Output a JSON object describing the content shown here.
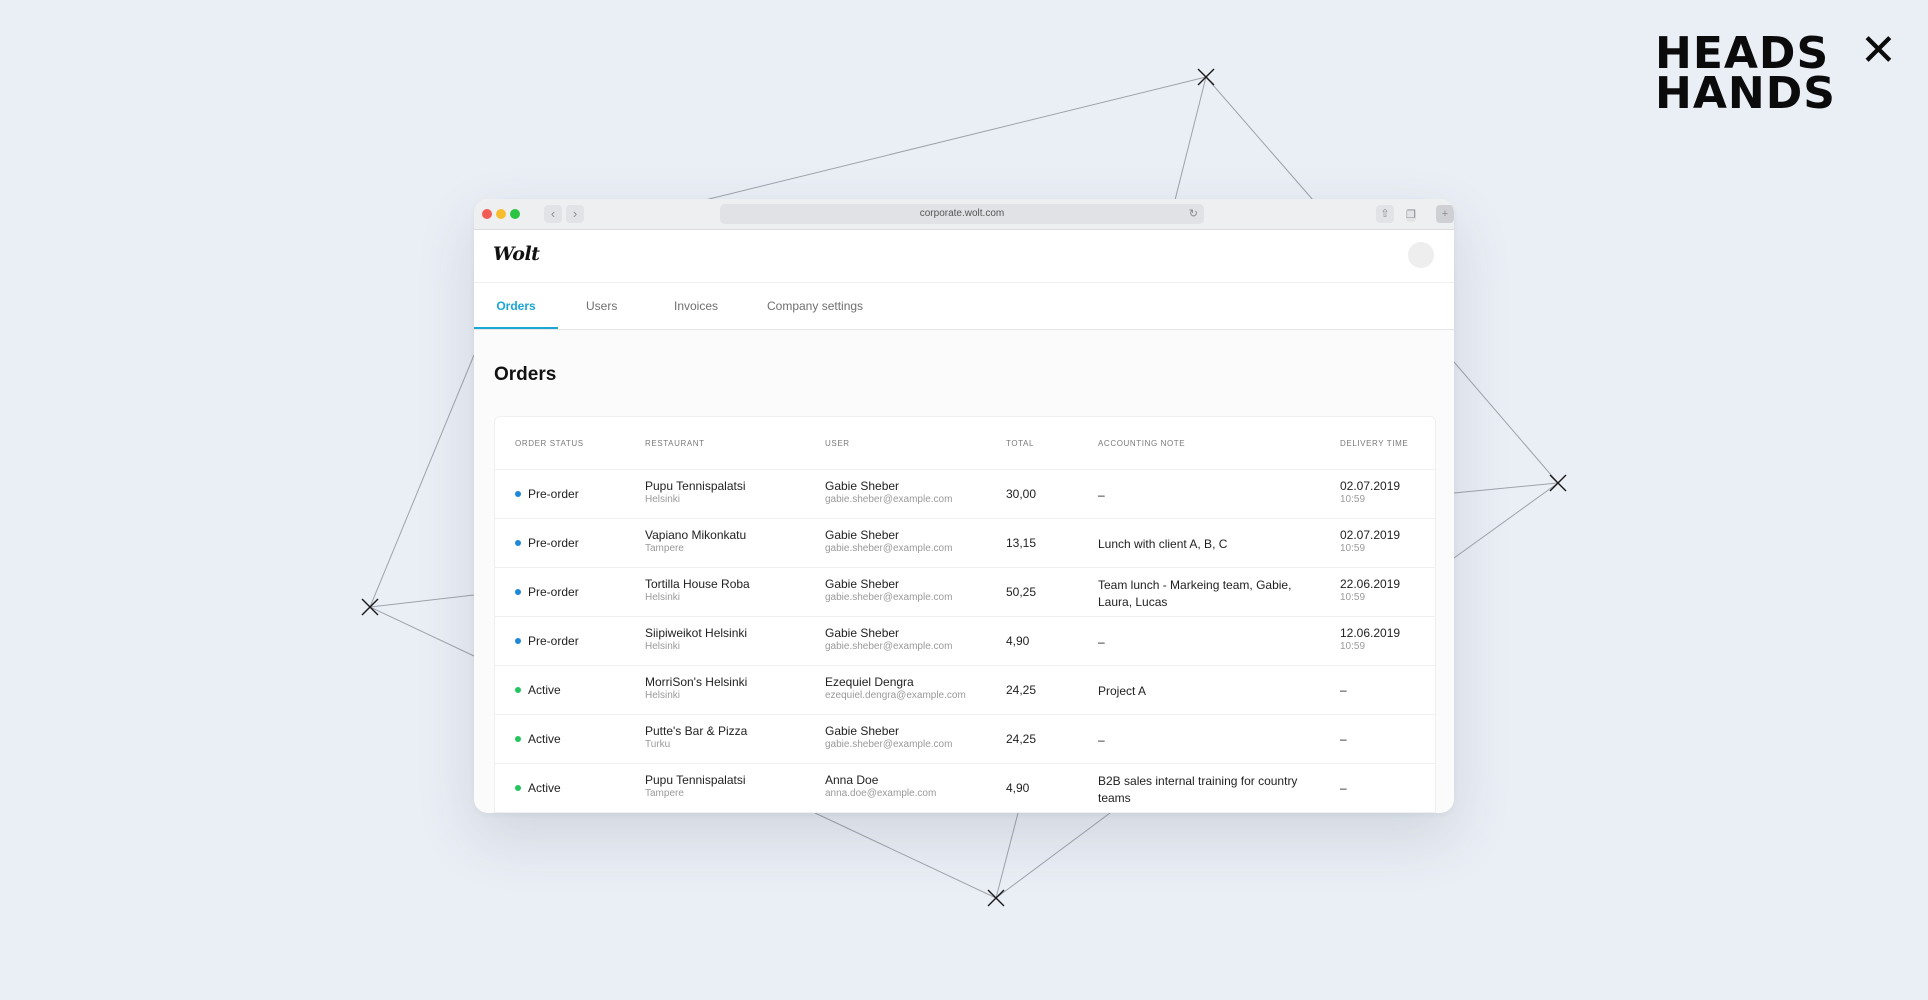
{
  "brand": {
    "line1": "HEADS",
    "line2": "HANDS",
    "mark": "✕"
  },
  "browser": {
    "url": "corporate.wolt.com"
  },
  "app": {
    "logo": "Wolt"
  },
  "tabs": [
    {
      "label": "Orders",
      "active": true
    },
    {
      "label": "Users",
      "active": false
    },
    {
      "label": "Invoices",
      "active": false
    },
    {
      "label": "Company settings",
      "active": false
    }
  ],
  "page": {
    "title": "Orders"
  },
  "colors": {
    "accent": "#1aa6d6",
    "preorder": "#1e88d8",
    "active": "#22c55e"
  },
  "table": {
    "headers": [
      "ORDER STATUS",
      "RESTAURANT",
      "USER",
      "TOTAL",
      "ACCOUNTING NOTE",
      "DELIVERY TIME"
    ],
    "rows": [
      {
        "status": "Pre-order",
        "restaurant": "Pupu Tennispalatsi",
        "city": "Helsinki",
        "user": "Gabie Sheber",
        "email": "gabie.sheber@example.com",
        "total": "30,00",
        "note": "–",
        "date": "02.07.2019",
        "time": "10:59"
      },
      {
        "status": "Pre-order",
        "restaurant": "Vapiano Mikonkatu",
        "city": "Tampere",
        "user": "Gabie Sheber",
        "email": "gabie.sheber@example.com",
        "total": "13,15",
        "note": "Lunch with client A, B, C",
        "date": "02.07.2019",
        "time": "10:59"
      },
      {
        "status": "Pre-order",
        "restaurant": "Tortilla House Roba",
        "city": "Helsinki",
        "user": "Gabie Sheber",
        "email": "gabie.sheber@example.com",
        "total": "50,25",
        "note": "Team lunch - Markeing team, Gabie,",
        "note2": "Laura, Lucas",
        "date": "22.06.2019",
        "time": "10:59"
      },
      {
        "status": "Pre-order",
        "restaurant": "Siipiweikot Helsinki",
        "city": "Helsinki",
        "user": "Gabie Sheber",
        "email": "gabie.sheber@example.com",
        "total": "4,90",
        "note": "–",
        "date": "12.06.2019",
        "time": "10:59"
      },
      {
        "status": "Active",
        "restaurant": "MorriSon's Helsinki",
        "city": "Helsinki",
        "user": "Ezequiel Dengra",
        "email": "ezequiel.dengra@example.com",
        "total": "24,25",
        "note": "Project A",
        "date": "–"
      },
      {
        "status": "Active",
        "restaurant": "Putte's Bar & Pizza",
        "city": "Turku",
        "user": "Gabie Sheber",
        "email": "gabie.sheber@example.com",
        "total": "24,25",
        "note": "–",
        "date": "–"
      },
      {
        "status": "Active",
        "restaurant": "Pupu Tennispalatsi",
        "city": "Tampere",
        "user": "Anna Doe",
        "email": "anna.doe@example.com",
        "total": "4,90",
        "note": "B2B sales internal training for country",
        "note2": "teams",
        "date": "–"
      }
    ]
  }
}
